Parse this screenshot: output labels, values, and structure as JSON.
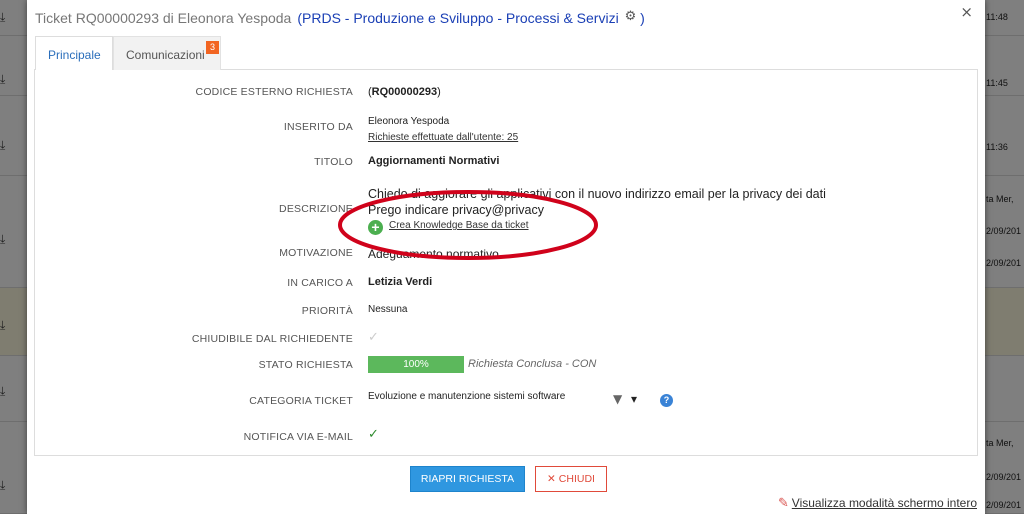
{
  "modal": {
    "title": "Ticket RQ00000293 di Eleonora Yespoda",
    "organization_open": "(PRDS - Produzione e Sviluppo - Processi & Servizi",
    "organization_close": ")",
    "gear_glyph": "⚙",
    "close_glyph": "×"
  },
  "tabs": [
    {
      "label": "Principale",
      "active": true
    },
    {
      "label": "Comunicazioni",
      "badge": "3"
    }
  ],
  "fields": {
    "codice_label": "CODICE ESTERNO RICHIESTA",
    "codice_open": "(",
    "codice_value": "RQ00000293",
    "codice_close": ")",
    "inserito_label": "INSERITO DA",
    "inserito_name": "Eleonora Yespoda",
    "inserito_link": "Richieste effettuate dall'utente: 25",
    "titolo_label": "TITOLO",
    "titolo_value": "Aggiornamenti Normativi",
    "descrizione_label": "DESCRIZIONE",
    "descrizione_line1": "Chiedo di aggiorare gli applicativi con il nuovo indirizzo email per la privacy dei dati",
    "descrizione_line2": "Prego indicare privacy@privacy",
    "kb_link": "Crea Knowledge Base da ticket",
    "motivazione_label": "MOTIVAZIONE",
    "motivazione_value": "Adeguamento normativo",
    "incarico_label": "IN CARICO A",
    "incarico_value": "Letizia Verdi",
    "priorita_label": "PRIORITÀ",
    "priorita_value": "Nessuna",
    "chiudibile_label": "CHIUDIBILE DAL RICHIEDENTE",
    "check_glyph": "✓",
    "stato_label": "STATO RICHIESTA",
    "stato_progress_text": "100%",
    "stato_progress_value": 1.0,
    "stato_text": "Richiesta Conclusa - CON",
    "categoria_label": "CATEGORIA TICKET",
    "categoria_value": "Evoluzione e manutenzione sistemi software",
    "funnel_glyph": "▼",
    "caret_glyph": "▾",
    "help_glyph": "?",
    "notifica_label": "NOTIFICA VIA E-MAIL"
  },
  "buttons": {
    "reopen": "RIAPRI RICHIESTA",
    "close_x": "✕",
    "close": "CHIUDI"
  },
  "footer": {
    "fullscreen_link": "Visualizza modalità schermo intero",
    "pencil_glyph": "✎"
  },
  "background": {
    "right_texts": [
      "11:48",
      "11:45",
      "11:36",
      "ta Mer,",
      "2/09/201",
      "2/09/201",
      "ta Mer,",
      "2/09/201",
      "2/09/201"
    ]
  },
  "colors": {
    "accent": "#2f97e0",
    "danger": "#e04a3a",
    "success": "#5cb85c",
    "badge": "#f26522",
    "annotation": "#d0021b"
  }
}
